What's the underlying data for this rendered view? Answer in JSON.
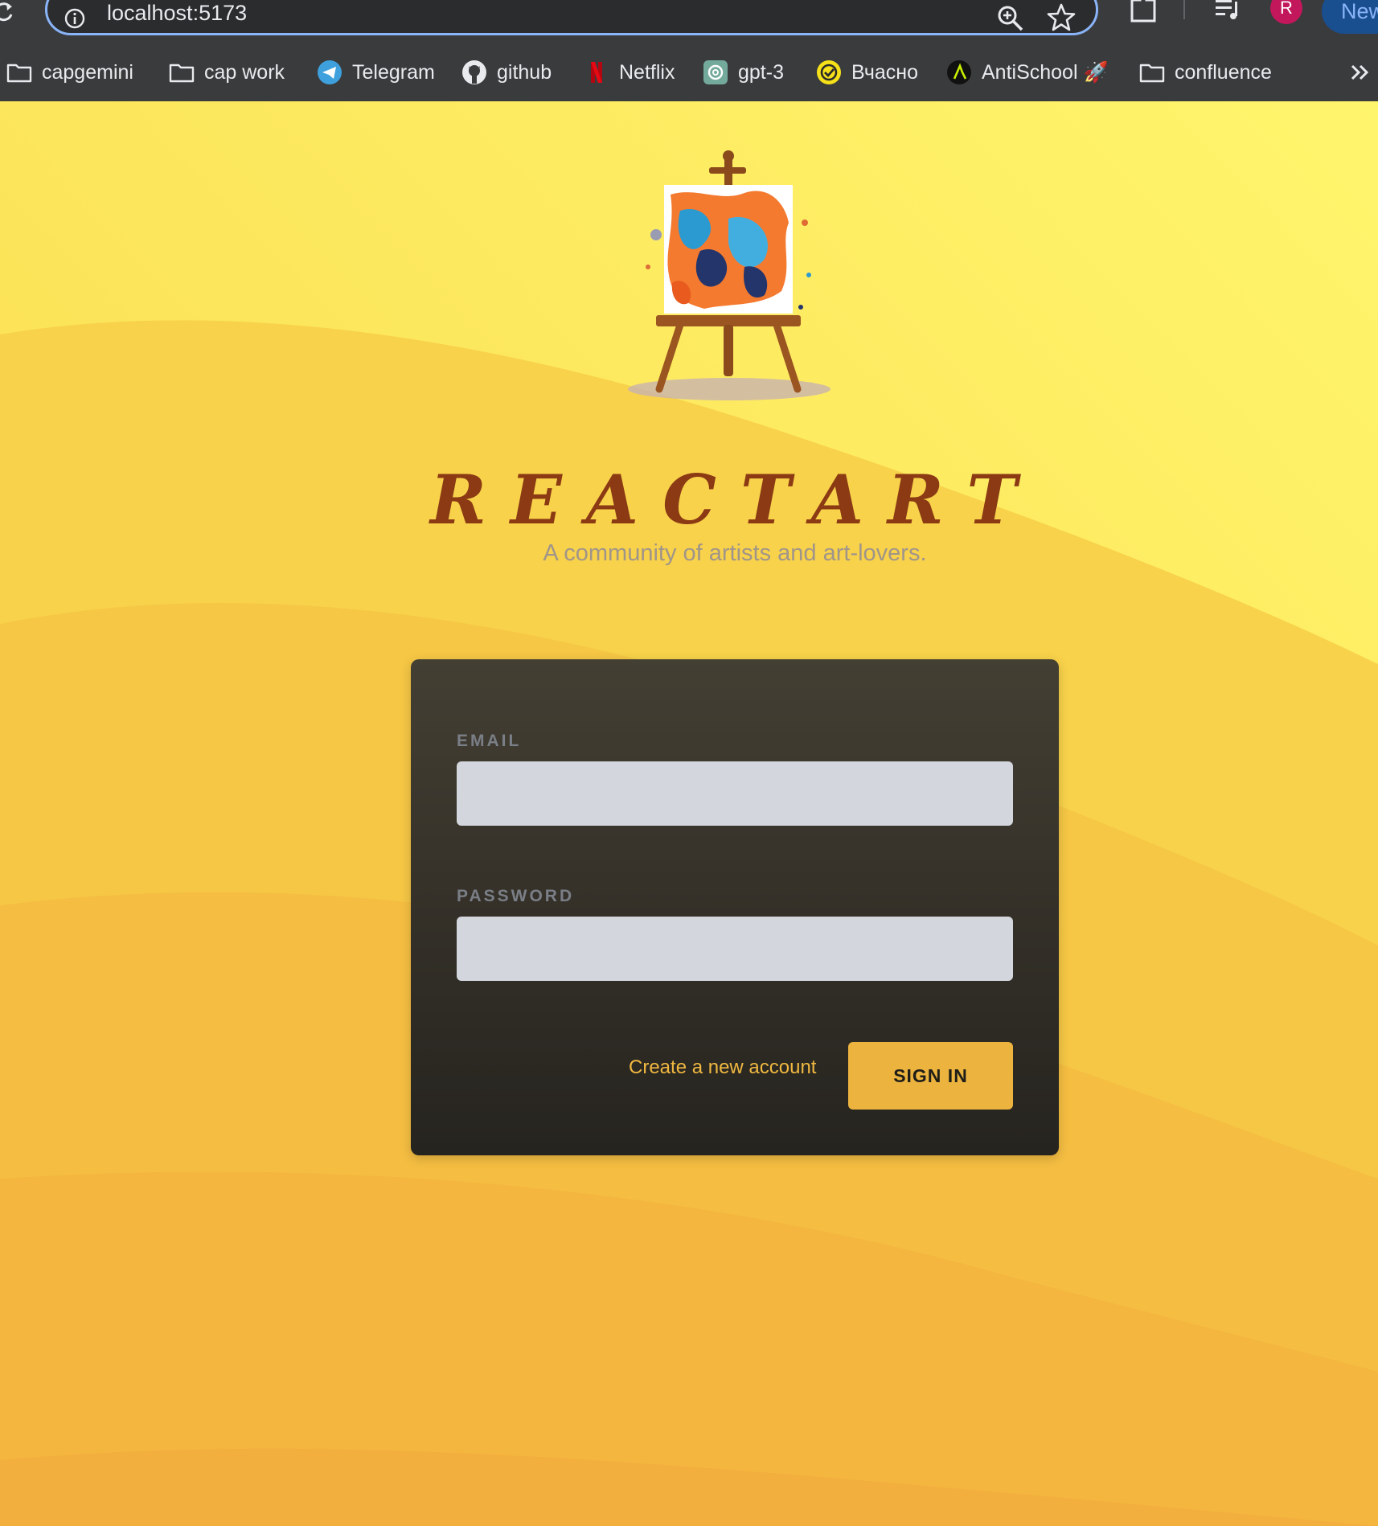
{
  "browser": {
    "url": "localhost:5173",
    "profile_initial": "R",
    "new_button_label": "New",
    "icons": [
      "reload-icon",
      "info-icon",
      "zoom-icon",
      "star-icon",
      "extensions-icon",
      "media-icon",
      "chevron-double-right-icon"
    ]
  },
  "bookmarks": [
    {
      "label": "capgemini",
      "icon": "folder-icon"
    },
    {
      "label": "cap work",
      "icon": "folder-icon"
    },
    {
      "label": "Telegram",
      "icon": "telegram-icon"
    },
    {
      "label": "github",
      "icon": "github-icon"
    },
    {
      "label": "Netflix",
      "icon": "netflix-icon"
    },
    {
      "label": "gpt-3",
      "icon": "openai-icon"
    },
    {
      "label": "Вчасно",
      "icon": "vchasno-icon"
    },
    {
      "label": "AntiSchool 🚀",
      "icon": "antischool-icon"
    },
    {
      "label": "confluence",
      "icon": "folder-icon"
    }
  ],
  "app": {
    "logo": "easel-painting-logo",
    "title": "REACTART",
    "tagline": "A community of artists and art-lovers."
  },
  "form": {
    "email_label": "EMAIL",
    "email_value": "",
    "password_label": "PASSWORD",
    "password_value": "",
    "create_account_label": "Create a new account",
    "sign_in_label": "SIGN IN"
  },
  "colors": {
    "background_light": "#fef36a",
    "background_dark": "#f5b841",
    "title": "#8b3a14",
    "card_top": "#433f33",
    "card_bottom": "#26241f",
    "input": "#d3d6dc",
    "accent": "#ecb43f",
    "link": "#f0b840",
    "chrome": "#3a3b3d"
  }
}
